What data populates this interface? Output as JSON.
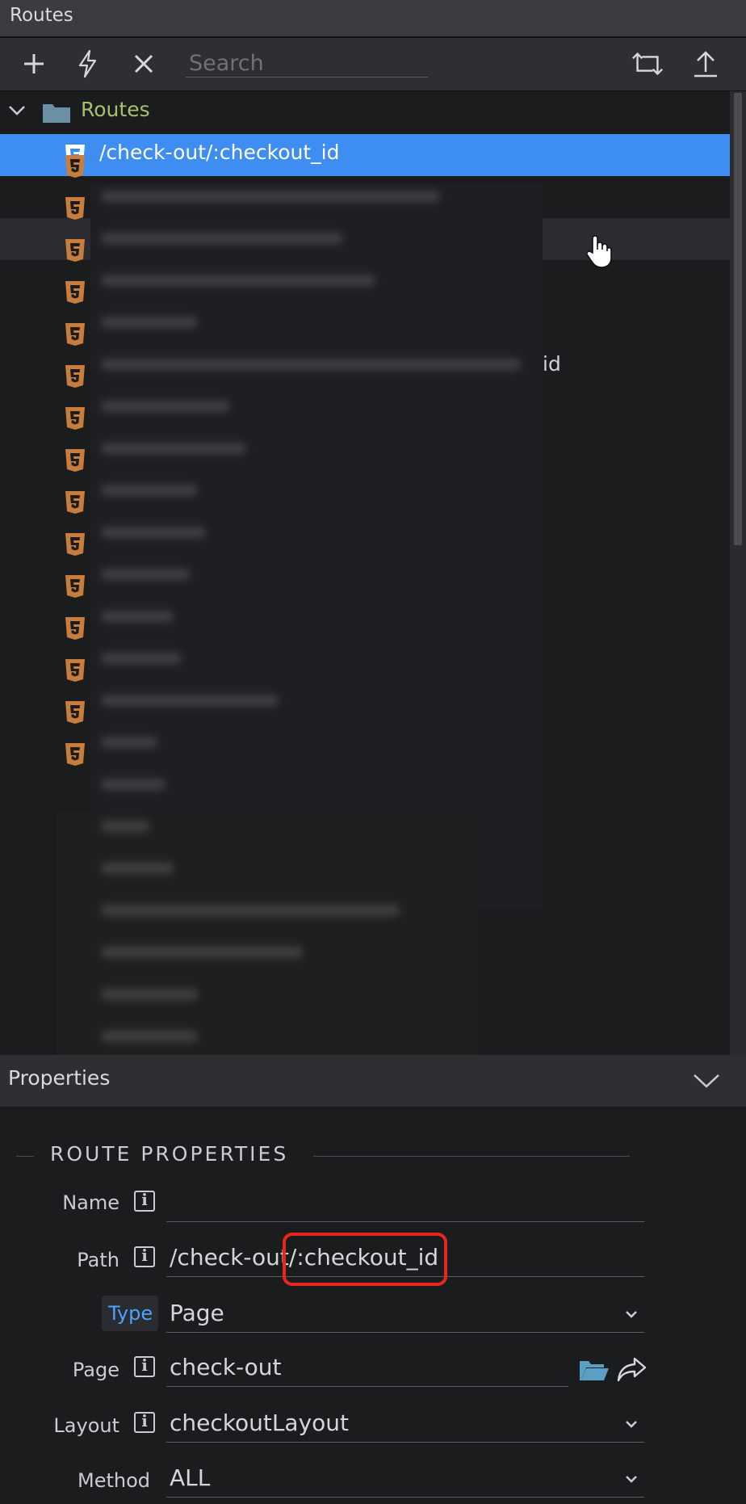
{
  "routes_panel": {
    "title": "Routes"
  },
  "toolbar": {
    "search_placeholder": "Search",
    "icons": [
      "plus-icon",
      "lightning-icon",
      "close-icon",
      "sync-icon",
      "upload-icon"
    ]
  },
  "tree": {
    "folder_label": "Routes",
    "selected_route": "/check-out/:checkout_id",
    "visible_fragment": "id"
  },
  "properties_panel": {
    "title": "Properties"
  },
  "route_properties": {
    "section_title": "ROUTE PROPERTIES",
    "name": {
      "label": "Name",
      "value": ""
    },
    "path": {
      "label": "Path",
      "value_prefix": "/check-out",
      "value_highlight": "/:checkout_id"
    },
    "type": {
      "label": "Type",
      "value": "Page"
    },
    "page": {
      "label": "Page",
      "value": "check-out"
    },
    "layout": {
      "label": "Layout",
      "value": "checkoutLayout"
    },
    "method": {
      "label": "Method",
      "value": "ALL"
    }
  },
  "colors": {
    "selected_row": "#3d8ef0",
    "folder_label": "#a8c26a",
    "html5_icon": "#c97d3d",
    "highlight_box": "#e8261c",
    "type_badge_text": "#4aa3ff"
  }
}
